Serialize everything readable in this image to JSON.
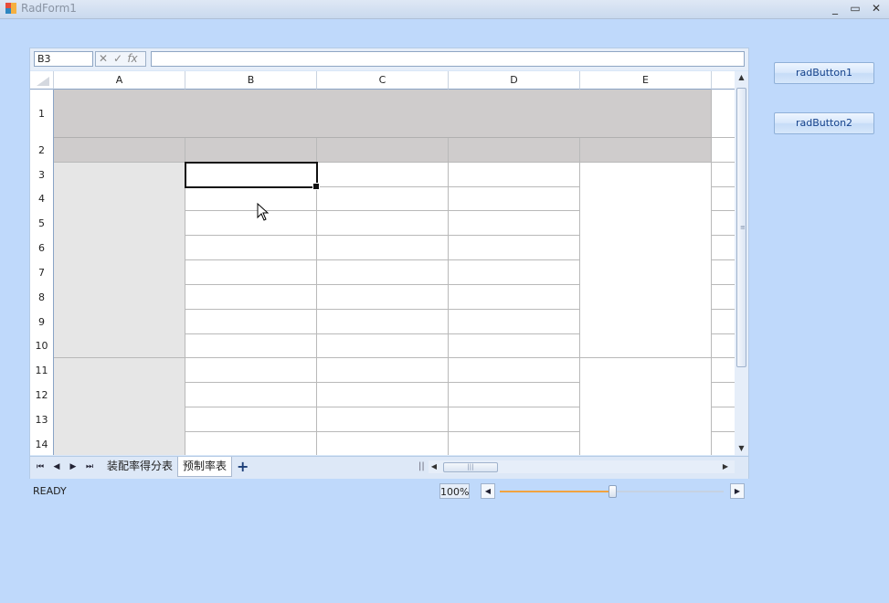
{
  "window": {
    "title": "RadForm1",
    "min_glyph": "_",
    "max_glyph": "▭",
    "close_glyph": "✕"
  },
  "formula_bar": {
    "name_box": "B3",
    "cancel_glyph": "✕",
    "enter_glyph": "✓",
    "fx_label": "fx",
    "formula": ""
  },
  "columns": [
    "A",
    "B",
    "C",
    "D",
    "E"
  ],
  "rows": [
    "1",
    "2",
    "3",
    "4",
    "5",
    "6",
    "7",
    "8",
    "9",
    "10",
    "11",
    "12",
    "13",
    "14"
  ],
  "active_cell": "B3",
  "sheet_tabs": {
    "first_glyph": "⏮",
    "prev_glyph": "◀",
    "next_glyph": "▶",
    "last_glyph": "⏭",
    "tabs": [
      {
        "label": "装配率得分表",
        "active": false
      },
      {
        "label": "预制率表",
        "active": true
      }
    ],
    "add_glyph": "+"
  },
  "status": {
    "text": "READY",
    "zoom_label": "100%",
    "zoom_fraction": 0.5
  },
  "buttons": {
    "button1": "radButton1",
    "button2": "radButton2"
  },
  "colors": {
    "background": "#bfd9fb",
    "header_fill": "#cfcccc",
    "column_a_fill": "#e6e6e6",
    "zoom_accent": "#f1a340",
    "button_text": "#15428b"
  },
  "icons": [
    "app-icon",
    "minimize-icon",
    "maximize-icon",
    "close-icon",
    "cancel-icon",
    "enter-icon",
    "fx-icon",
    "scroll-up-icon",
    "scroll-down-icon",
    "scroll-left-icon",
    "scroll-right-icon",
    "add-sheet-icon",
    "zoom-out-icon",
    "zoom-in-icon",
    "mouse-cursor-icon"
  ]
}
